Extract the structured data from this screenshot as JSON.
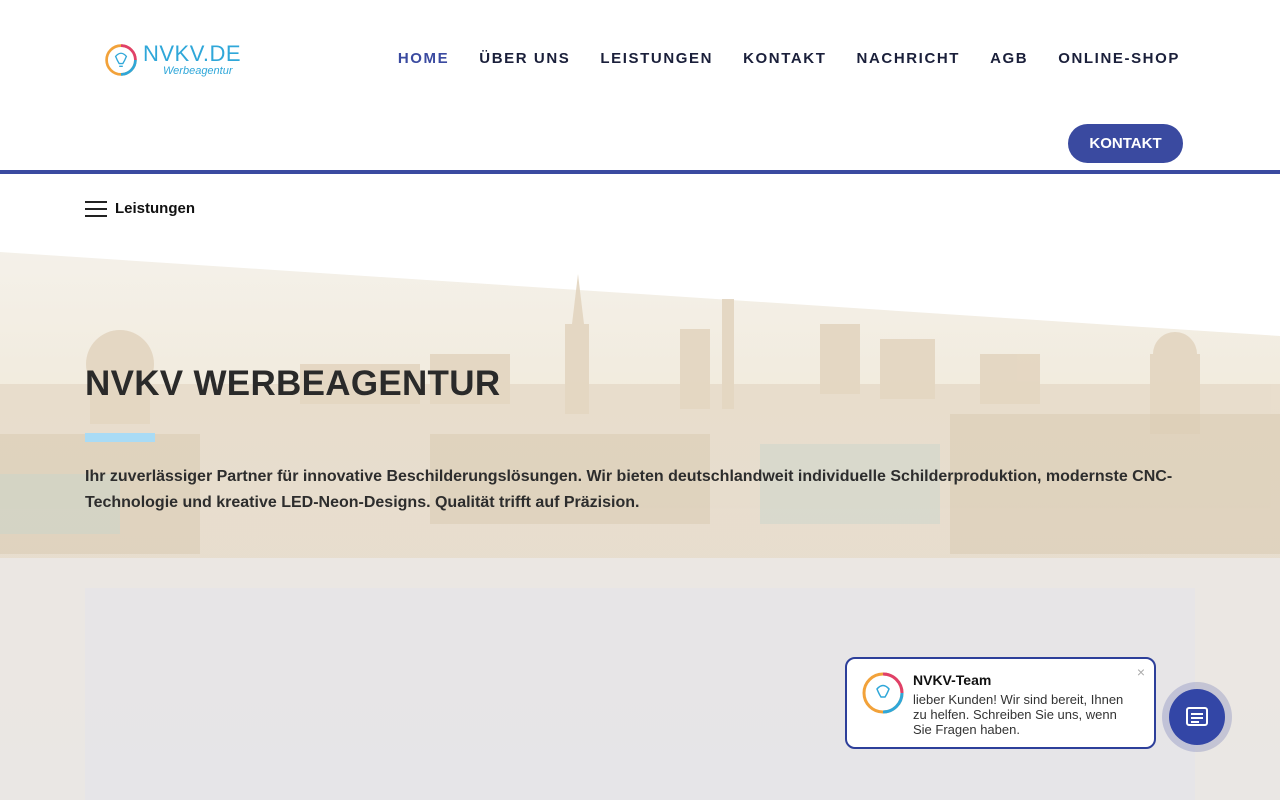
{
  "logo": {
    "name": "NVKV.DE",
    "subtitle": "Werbeagentur"
  },
  "nav": {
    "items": [
      {
        "label": "HOME",
        "active": true
      },
      {
        "label": "ÜBER UNS"
      },
      {
        "label": "LEISTUNGEN"
      },
      {
        "label": "KONTAKT"
      },
      {
        "label": "NACHRICHT"
      },
      {
        "label": "AGB"
      },
      {
        "label": "ONLINE-SHOP"
      }
    ],
    "cta_label": "KONTAKT"
  },
  "submenu": {
    "label": "Leistungen"
  },
  "hero": {
    "title": "NVKV WERBEAGENTUR",
    "text": "Ihr zuverlässiger Partner für innovative Beschilderungslösungen. Wir bieten deutschlandweit individuelle Schilderproduktion, modernste CNC-Technologie und kreative LED-Neon-Designs. Qualität trifft auf Präzision."
  },
  "chat": {
    "name": "NVKV-Team",
    "message": "lieber Kunden! Wir sind bereit, Ihnen zu helfen. Schreiben Sie uns, wenn Sie Fragen haben.",
    "close": "×"
  },
  "colors": {
    "primary": "#3a4aa0",
    "accent": "#a9dbf5",
    "logo": "#2fa7d9"
  },
  "icons": [
    "logo-bulb-icon",
    "hamburger-icon",
    "close-icon",
    "chat-icon"
  ]
}
